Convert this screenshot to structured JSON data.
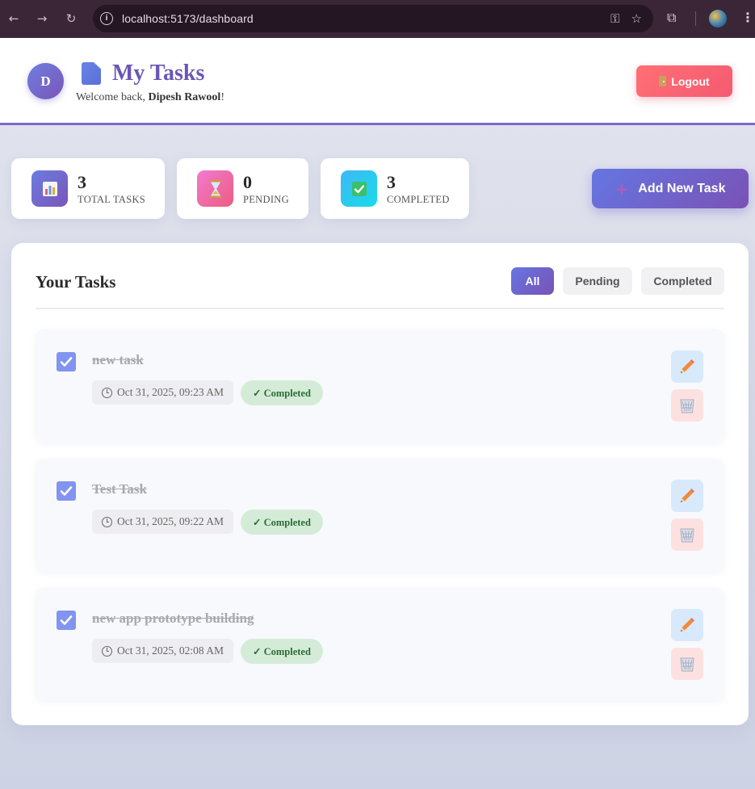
{
  "browser": {
    "url": "localhost:5173/dashboard",
    "back_icon": "←",
    "forward_icon": "→",
    "reload_icon": "↻"
  },
  "header": {
    "avatar_initial": "D",
    "title": "My Tasks",
    "welcome_prefix": "Welcome back, ",
    "user_name": "Dipesh Rawool",
    "welcome_suffix": "!",
    "logout_label": "Logout"
  },
  "stats": [
    {
      "value": "3",
      "label": "TOTAL TASKS"
    },
    {
      "value": "0",
      "label": "PENDING"
    },
    {
      "value": "3",
      "label": "COMPLETED"
    }
  ],
  "add_task_label": "Add New Task",
  "tasks_panel": {
    "title": "Your Tasks",
    "filters": [
      "All",
      "Pending",
      "Completed"
    ],
    "active_filter": "All"
  },
  "tasks": [
    {
      "title": "new task",
      "date": "Oct 31, 2025, 09:23 AM",
      "status": "✓ Completed",
      "completed": true
    },
    {
      "title": "Test Task",
      "date": "Oct 31, 2025, 09:22 AM",
      "status": "✓ Completed",
      "completed": true
    },
    {
      "title": "new app prototype building",
      "date": "Oct 31, 2025, 02:08 AM",
      "status": "✓ Completed",
      "completed": true
    }
  ],
  "colors": {
    "accent": "#7b6bc9",
    "logout": "#f45b72",
    "completed_badge": "#d4ecd7",
    "checkbox": "#8194ef"
  }
}
